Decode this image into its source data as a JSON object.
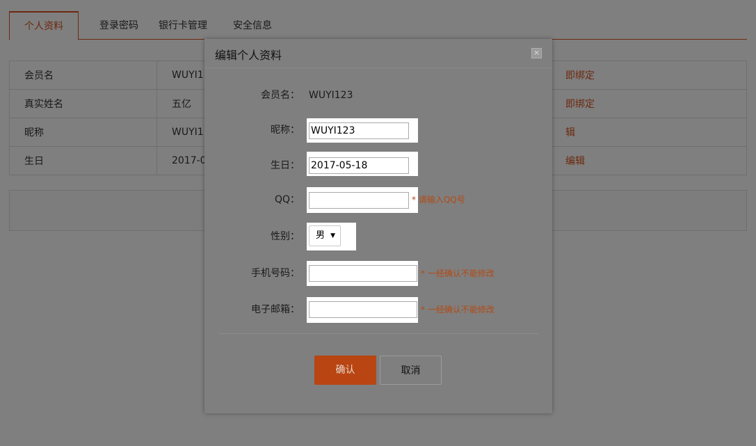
{
  "tabs": [
    "个人资料",
    "登录密码",
    "银行卡管理",
    "安全信息"
  ],
  "table": [
    {
      "label": "会员名",
      "value": "WUYI1",
      "action": "即绑定"
    },
    {
      "label": "真实姓名",
      "value": "五亿",
      "action": "即绑定"
    },
    {
      "label": "昵称",
      "value": "WUYI1",
      "action": "辑"
    },
    {
      "label": "生日",
      "value": "2017-0",
      "action": "编辑"
    }
  ],
  "modal": {
    "title": "编辑个人资料",
    "close": "×",
    "member_label": "会员名：",
    "member_value": "WUYI123",
    "nickname_label": "昵称：",
    "nickname_value": "WUYI123",
    "birthday_label": "生日：",
    "birthday_value": "2017-05-18",
    "qq_label": "QQ：",
    "qq_value": "",
    "qq_hint": "* 请输入QQ号",
    "gender_label": "性别：",
    "gender_value": "男",
    "phone_label": "手机号码：",
    "phone_value": "",
    "phone_hint": "* 一经确认不能修改",
    "email_label": "电子邮箱：",
    "email_value": "",
    "email_hint": "* 一经确认不能修改",
    "confirm_label": "确认",
    "cancel_label": "取消"
  },
  "colors": {
    "accent": "#d9531e",
    "overlay": "rgba(0,0,0,0.5)"
  }
}
